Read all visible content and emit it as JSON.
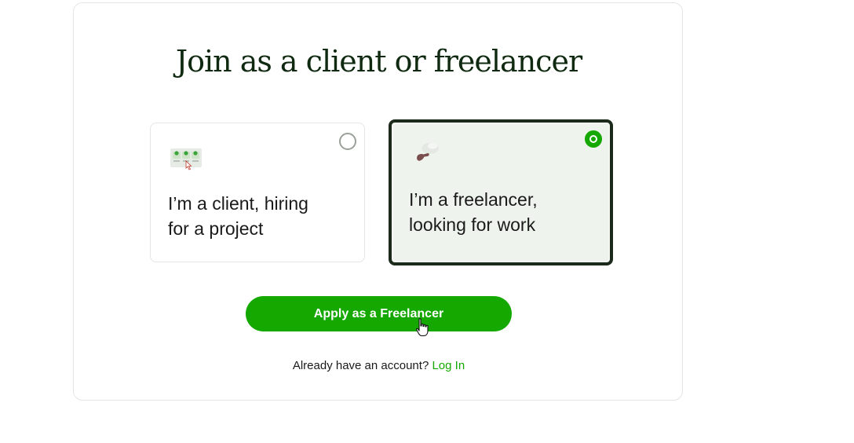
{
  "page": {
    "title": "Join as a client or freelancer"
  },
  "options": {
    "client": {
      "label": "I’m a client, hiring\nfor a project",
      "selected": false,
      "icon": "client-hiring-icon"
    },
    "freelancer": {
      "label": "I’m a freelancer,\nlooking for work",
      "selected": true,
      "icon": "freelancer-icon"
    }
  },
  "cta": {
    "label": "Apply as a Freelancer"
  },
  "login": {
    "prompt": "Already have an account?",
    "link_label": "Log In"
  },
  "colors": {
    "accent": "#14a800",
    "selected_border": "#1b2a1b",
    "selected_background": "#eef4ed",
    "title_text": "#0f2a10"
  }
}
